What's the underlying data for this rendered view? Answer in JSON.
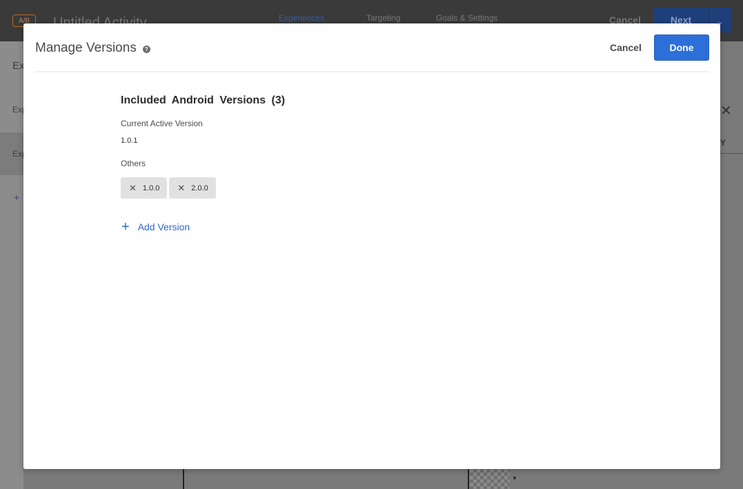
{
  "background": {
    "badge": "A/B",
    "activity_title": "Untitled Activity",
    "tabs": [
      {
        "label": "Experiences"
      },
      {
        "label": "Targeting"
      },
      {
        "label": "Goals & Settings"
      }
    ],
    "cancel_label": "Cancel",
    "next_label": "Next",
    "left_rows": [
      "Ex",
      "Exp",
      "Exp",
      "+"
    ],
    "right_col_letter": "Y"
  },
  "modal": {
    "title": "Manage Versions",
    "help_icon": "?",
    "cancel_label": "Cancel",
    "done_label": "Done",
    "section_title": "Included Android Versions (3)",
    "current_label": "Current Active Version",
    "current_value": "1.0.1",
    "others_label": "Others",
    "others": [
      "1.0.0",
      "2.0.0"
    ],
    "add_version_label": "Add Version"
  },
  "colors": {
    "accent": "#2d6fd8",
    "link": "#2c6ac6",
    "tag_bg": "#e1e1e1"
  }
}
